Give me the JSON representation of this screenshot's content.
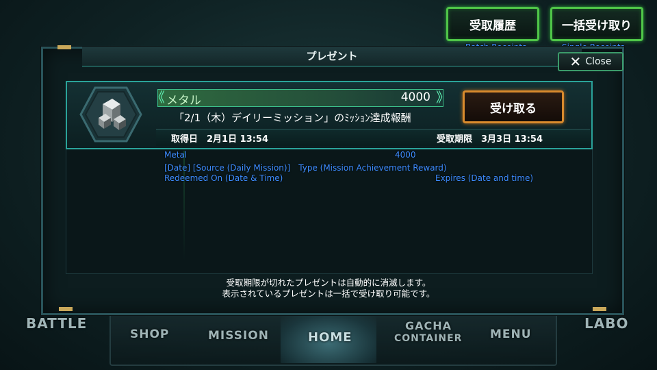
{
  "top_buttons": {
    "receipts_label": "受取履歴",
    "batch_label": "一括受け取り",
    "receipts_annotation": "Batch Receipts",
    "batch_annotation": "Single Receipts"
  },
  "dialog": {
    "title": "プレゼント",
    "close_label": "Close",
    "footer_line1": "受取期限が切れたプレゼントは自動的に消滅します。",
    "footer_line2": "表示されているプレゼントは一括で受け取り可能です。"
  },
  "item": {
    "name": "メタル",
    "quantity": "4000",
    "description": "「2/1（木）デイリーミッション」のﾐｯｼｮﾝ達成報酬",
    "receive_label": "受け取る",
    "obtained": "取得日　2月1日 13:54",
    "deadline": "受取期限　3月3日 13:54"
  },
  "annotations": {
    "name": "Metal",
    "quantity": "4000",
    "description": "[Date] [Source (Daily Mission)]　Type (Mission Achievement Reward)",
    "obtained": "Redeemed On (Date & Time)",
    "deadline": "Expires (Date and time)"
  },
  "bottom_nav": {
    "battle": "BATTLE",
    "shop": "SHOP",
    "mission": "MISSION",
    "home": "HOME",
    "gacha": "GACHA",
    "container": "CONTAINER",
    "menu": "MENU",
    "labo": "LABO"
  },
  "icons": [
    "metal-crystal-icon",
    "close-x-icon",
    "arrow-left-icon",
    "arrow-right-icon"
  ],
  "colors": {
    "accent_green": "#4fc548",
    "accent_teal": "#2aa39a",
    "accent_orange": "#d88a2d",
    "annotation_blue": "#3d8cff"
  }
}
